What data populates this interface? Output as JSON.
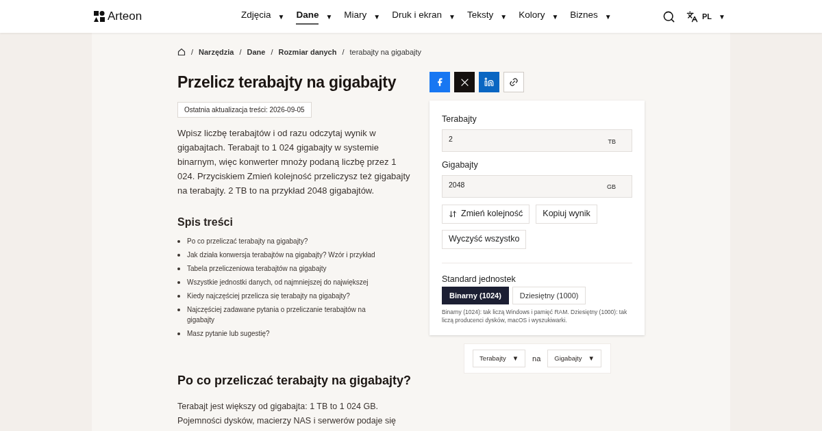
{
  "header": {
    "logo": "Arteon",
    "nav": [
      {
        "label": "Zdjęcia",
        "selected": false
      },
      {
        "label": "Dane",
        "selected": true
      },
      {
        "label": "Miary",
        "selected": false
      },
      {
        "label": "Druk i ekran",
        "selected": false
      },
      {
        "label": "Teksty",
        "selected": false
      },
      {
        "label": "Kolory",
        "selected": false
      },
      {
        "label": "Biznes",
        "selected": false
      }
    ],
    "caret": "▼",
    "language": "PL"
  },
  "breadcrumb": [
    {
      "label": "Narzędzia",
      "kind": "link"
    },
    {
      "label": "Dane",
      "kind": "link"
    },
    {
      "label": "Rozmiar danych",
      "kind": "link"
    },
    {
      "label": "terabajty na gigabajty",
      "kind": "current"
    }
  ],
  "breadcrumb_separator": "/",
  "title": "Przelicz terabajty na gigabajty",
  "updated": "Ostatnia aktualizacja treści: 2026-09-05",
  "intro": "Wpisz liczbę terabajtów i od razu odczytaj wynik w gigabajtach. Terabajt to 1 024 gigabajty w systemie binarnym, więc konwerter mnoży podaną liczbę przez 1 024. Przyciskiem Zmień kolejność przeliczysz też gigabajty na terabajty. 2 TB to na przykład 2048 gigabajtów.",
  "toc": {
    "title": "Spis treści",
    "items": [
      "Po co przeliczać terabajty na gigabajty?",
      "Jak działa konwersja terabajtów na gigabajty? Wzór i przykład",
      "Tabela przeliczeniowa terabajtów na gigabajty",
      "Wszystkie jednostki danych, od najmniejszej do największej",
      "Kiedy najczęściej przelicza się terabajty na gigabajty?",
      "Najczęściej zadawane pytania o przeliczanie terabajtów na gigabajty",
      "Masz pytanie lub sugestię?"
    ]
  },
  "section": {
    "title": "Po co przeliczać terabajty na gigabajty?",
    "text": "Terabajt jest większy od gigabajta: 1 TB to 1 024 GB. Pojemności dysków, macierzy NAS i serwerów podaje się"
  },
  "share": [
    {
      "kind": "facebook"
    },
    {
      "kind": "x"
    },
    {
      "kind": "linkedin"
    },
    {
      "kind": "link"
    }
  ],
  "converter": {
    "fields": [
      {
        "label": "Terabajty",
        "value": "2",
        "unit": "TB"
      },
      {
        "label": "Gigabajty",
        "value": "2048",
        "unit": "GB"
      }
    ],
    "buttons": [
      {
        "label": "Zmień kolejność",
        "kind": "swap"
      },
      {
        "label": "Kopiuj wynik",
        "kind": "plain"
      },
      {
        "label": "Wyczyść wszystko",
        "kind": "plain"
      }
    ],
    "standard": {
      "title": "Standard jednostek",
      "options": [
        {
          "label": "Binarny (1024)",
          "selected": true
        },
        {
          "label": "Dziesiętny (1000)",
          "selected": false
        }
      ],
      "note": "Binarny (1024): tak liczą Windows i pamięć RAM. Dziesiętny (1000): tak liczą producenci dysków, macOS i wyszukiwarki."
    }
  },
  "unit_picker": {
    "from": "Terabajty",
    "joiner": "na",
    "to": "Gigabajty"
  }
}
